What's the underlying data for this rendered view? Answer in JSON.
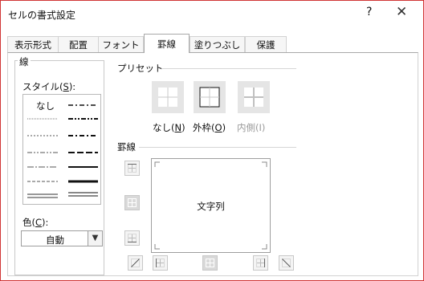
{
  "window": {
    "title": "セルの書式設定",
    "help_label": "?",
    "close_label": "✕"
  },
  "tabs": [
    {
      "label": "表示形式",
      "active": false
    },
    {
      "label": "配置",
      "active": false
    },
    {
      "label": "フォント",
      "active": false
    },
    {
      "label": "罫線",
      "active": true
    },
    {
      "label": "塗りつぶし",
      "active": false
    },
    {
      "label": "保護",
      "active": false
    }
  ],
  "line_group": {
    "label": "線",
    "style_label": "スタイル(",
    "style_key": "S",
    "style_label_end": "):",
    "none_label": "なし",
    "color_label": "色(",
    "color_key": "C",
    "color_label_end": "):",
    "color_value": "自動"
  },
  "preset_group": {
    "label": "プリセット",
    "items": [
      {
        "label": "なし(",
        "key": "N",
        "end": ")",
        "enabled": true
      },
      {
        "label": "外枠(",
        "key": "O",
        "end": ")",
        "enabled": true
      },
      {
        "label": "内側(",
        "key": "I",
        "end": ")",
        "enabled": false
      }
    ]
  },
  "border_group": {
    "label": "罫線",
    "preview_text": "文字列"
  },
  "colors": {
    "dialog_border": "#d03535",
    "tab_border": "#a9a9a9",
    "disabled_text": "#9a9a9a",
    "preset_bg": "#e5e5e5"
  }
}
